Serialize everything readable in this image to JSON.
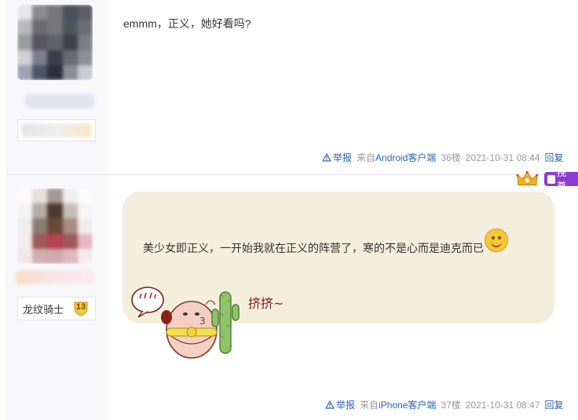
{
  "posts": [
    {
      "content": "emmm，正义，她好看吗?",
      "report_label": "举报",
      "client_prefix": "来自",
      "client_name": "Android客户端",
      "floor": "36楼",
      "time": "2021-10-31 08:44",
      "reply_label": "回复"
    },
    {
      "content": "美少女即正义，一开始我就在正义的阵营了，寒的不是心而是迪克而已",
      "report_label": "举报",
      "client_prefix": "来自",
      "client_name": "iPhone客户端",
      "floor": "37楼",
      "time": "2021-10-31 08:47",
      "reply_label": "回复",
      "user": {
        "rank_title": "龙纹骑士",
        "level": "13"
      },
      "vip_label": "挽尊",
      "sticker_text": "挤挤~"
    }
  ],
  "colors": {
    "link": "#2d64b3",
    "bubble_bg": "#f4efdd"
  }
}
